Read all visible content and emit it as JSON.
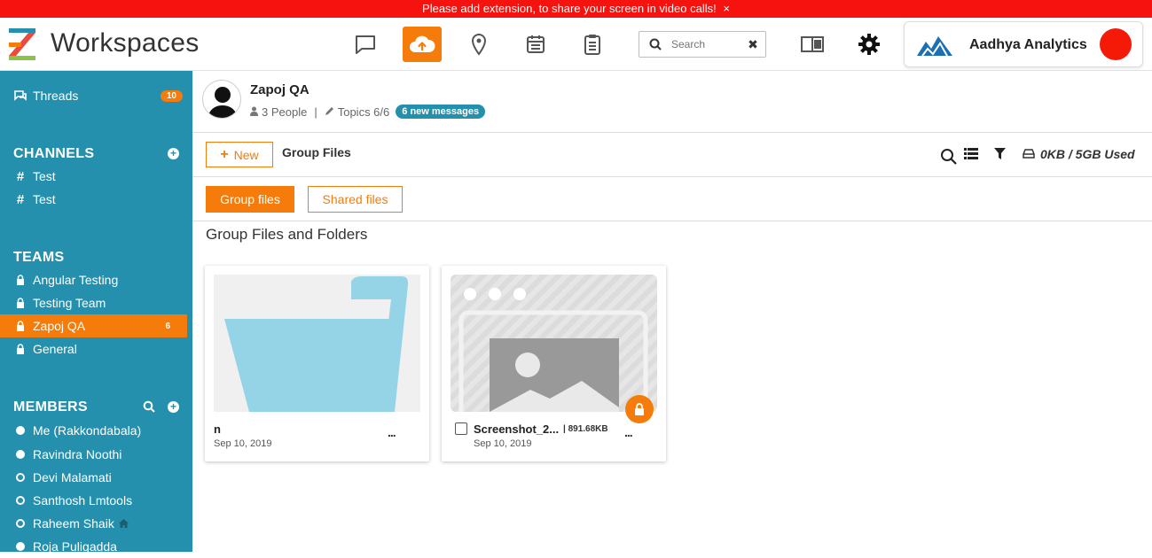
{
  "banner": {
    "text": "Please add extension, to share your screen in video calls!",
    "close": "×"
  },
  "topbar": {
    "brand": "Workspaces",
    "search_placeholder": "Search",
    "search_clear": "✖",
    "org_name": "Aadhya Analytics",
    "icons": [
      "chat-icon",
      "upload-cloud-icon",
      "location-pin-icon",
      "calendar-icon",
      "clipboard-icon",
      "reader-icon",
      "gear-icon"
    ]
  },
  "sidebar": {
    "threads": {
      "label": "Threads",
      "count": "10"
    },
    "channels": {
      "heading": "CHANNELS",
      "items": [
        {
          "label": "Test"
        },
        {
          "label": "Test"
        }
      ]
    },
    "teams": {
      "heading": "TEAMS",
      "items": [
        {
          "label": "Angular Testing",
          "count": ""
        },
        {
          "label": "Testing Team",
          "count": ""
        },
        {
          "label": "Zapoj QA",
          "count": "6"
        },
        {
          "label": "General",
          "count": ""
        }
      ]
    },
    "members": {
      "heading": "MEMBERS",
      "items": [
        {
          "label": "Me (Rakkondabala)",
          "online": true
        },
        {
          "label": "Ravindra Noothi",
          "online": true
        },
        {
          "label": "Devi Malamati",
          "online": false
        },
        {
          "label": "Santhosh Lmtools",
          "online": false
        },
        {
          "label": "Raheem Shaik",
          "online": false
        },
        {
          "label": "Roja Puligadda",
          "online": true
        }
      ]
    }
  },
  "group": {
    "title": "Zapoj QA",
    "people": "3 People",
    "separator": "|",
    "topics": "Topics 6/6",
    "new_messages": "6 new messages"
  },
  "toolbar": {
    "new_label": "New",
    "new_plus": "+",
    "title": "Group Files",
    "storage": "0KB / 5GB Used"
  },
  "tabs": {
    "group_files": "Group files",
    "shared_files": "Shared files"
  },
  "section_title": "Group Files and Folders",
  "files": [
    {
      "name": "n",
      "date": "Sep 10, 2019",
      "size": "",
      "type": "folder",
      "more": "..."
    },
    {
      "name": "Screenshot_2...",
      "date": "Sep 10, 2019",
      "size": "| 891.68KB",
      "type": "image",
      "locked": true,
      "more": "..."
    }
  ],
  "colors": {
    "accent": "#f57c0a",
    "sidebar": "#2490ad",
    "banner": "#f5120f",
    "folder": "#94d4e6"
  }
}
